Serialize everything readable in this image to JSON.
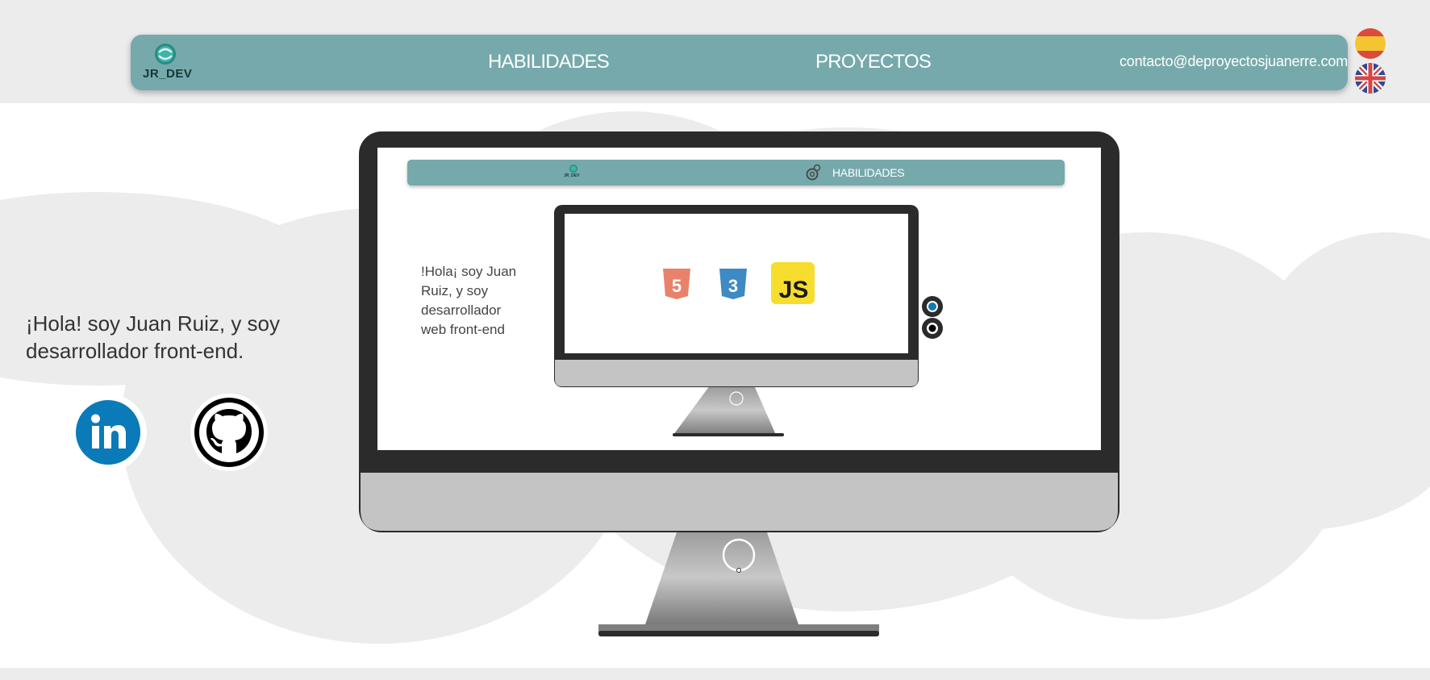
{
  "header": {
    "logo_text": "JR_DEV",
    "nav": {
      "skills_label": "HABILIDADES",
      "projects_label": "PROYECTOS",
      "email": "contacto@deproyectosjuanerre.com"
    },
    "languages": [
      {
        "name": "spanish-flag-icon"
      },
      {
        "name": "uk-flag-icon"
      }
    ]
  },
  "hero": {
    "intro_text": "¡Hola! soy Juan Ruiz, y soy desarrollador front-end.",
    "social": [
      {
        "name": "linkedin-icon",
        "color": "#0a7ab8"
      },
      {
        "name": "github-icon",
        "color": "#000000"
      }
    ]
  },
  "preview": {
    "mini_logo_text": "JR_DEV",
    "mini_nav_label": "HABILIDADES",
    "mini_intro_text": "!Hola¡ soy Juan Ruiz, y soy desarrollador web front-end",
    "skills": [
      {
        "label": "5",
        "name": "html5-icon",
        "color": "#e9826a"
      },
      {
        "label": "3",
        "name": "css3-icon",
        "color": "#3e8ac4"
      },
      {
        "label": "JS",
        "name": "javascript-icon",
        "color": "#f7de2e"
      }
    ]
  },
  "colors": {
    "accent": "#76a9ab",
    "background": "#ececec",
    "cloud": "#ececec"
  }
}
